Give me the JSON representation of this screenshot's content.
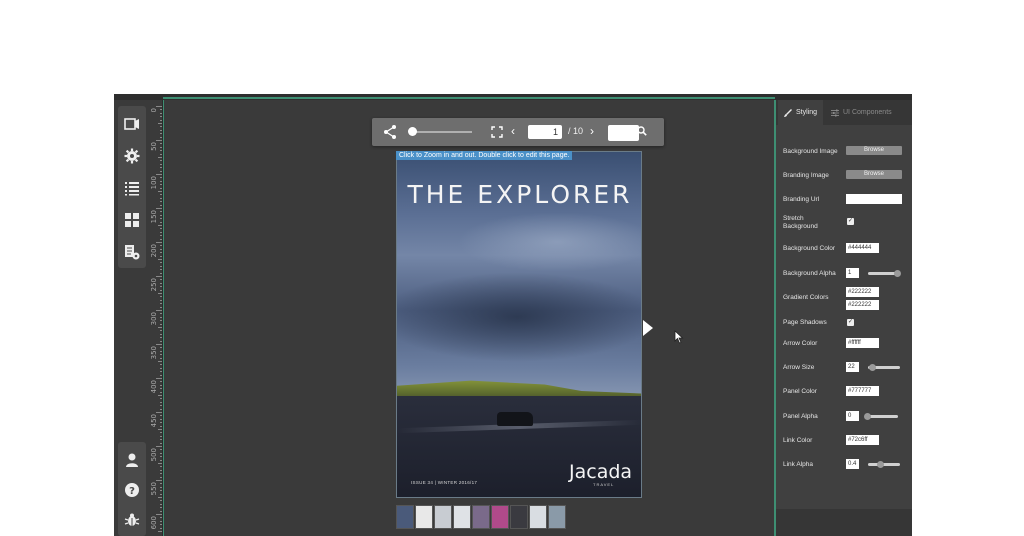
{
  "sidebar": {
    "top_icons": [
      "flipbook-icon",
      "gear-icon",
      "list-icon",
      "grid-icon",
      "pages-settings-icon"
    ],
    "bottom_icons": [
      "user-icon",
      "help-icon",
      "bug-icon"
    ]
  },
  "ruler": {
    "labels": [
      "0",
      "50",
      "100",
      "150",
      "200",
      "250",
      "300",
      "350",
      "400",
      "450",
      "500",
      "550",
      "600"
    ]
  },
  "toolbar": {
    "page_value": "1",
    "page_total": "/ 10",
    "search_value": ""
  },
  "viewer": {
    "hint": "Click to Zoom in and out. Double click to edit this page.",
    "cover_title": "THE EXPLORER",
    "cover_issue": "ISSUE 34 | WINTER 2016/17",
    "cover_brand": "Jacada",
    "cover_brand_sub": "TRAVEL"
  },
  "thumbnails": [
    "#4a5a7a",
    "#e8e8e8",
    "#c8ccd2",
    "#dfe2e6",
    "#7a6a8a",
    "#b04a8a",
    "#3a3a40",
    "#d9dde2",
    "#8a9aa8"
  ],
  "panel": {
    "tabs": {
      "styling": "Styling",
      "components": "UI Components"
    },
    "labels": {
      "background_image": "Background Image",
      "branding_image": "Branding Image",
      "branding_url": "Branding Url",
      "stretch_background": "Stretch\nBackground",
      "background_color": "Background Color",
      "background_alpha": "Background Alpha",
      "gradient_colors": "Gradient Colors",
      "page_shadows": "Page Shadows",
      "arrow_color": "Arrow Color",
      "arrow_size": "Arrow Size",
      "panel_color": "Panel Color",
      "panel_alpha": "Panel Alpha",
      "link_color": "Link Color",
      "link_alpha": "Link Alpha"
    },
    "browse_label": "Browse",
    "values": {
      "branding_url": "",
      "background_color": "#444444",
      "background_alpha": "1",
      "gradient_color_1": "#222222",
      "gradient_color_2": "#222222",
      "arrow_color": "#ffffff",
      "arrow_size": "22",
      "panel_color": "#777777",
      "panel_alpha": "0",
      "link_color": "#72c6ff",
      "link_alpha": "0.4"
    },
    "checks": {
      "stretch_background": true,
      "page_shadows": true
    },
    "slider_levels": {
      "background_alpha": 1.0,
      "arrow_size": 0.1,
      "panel_alpha": 0.0,
      "link_alpha": 0.4
    }
  }
}
